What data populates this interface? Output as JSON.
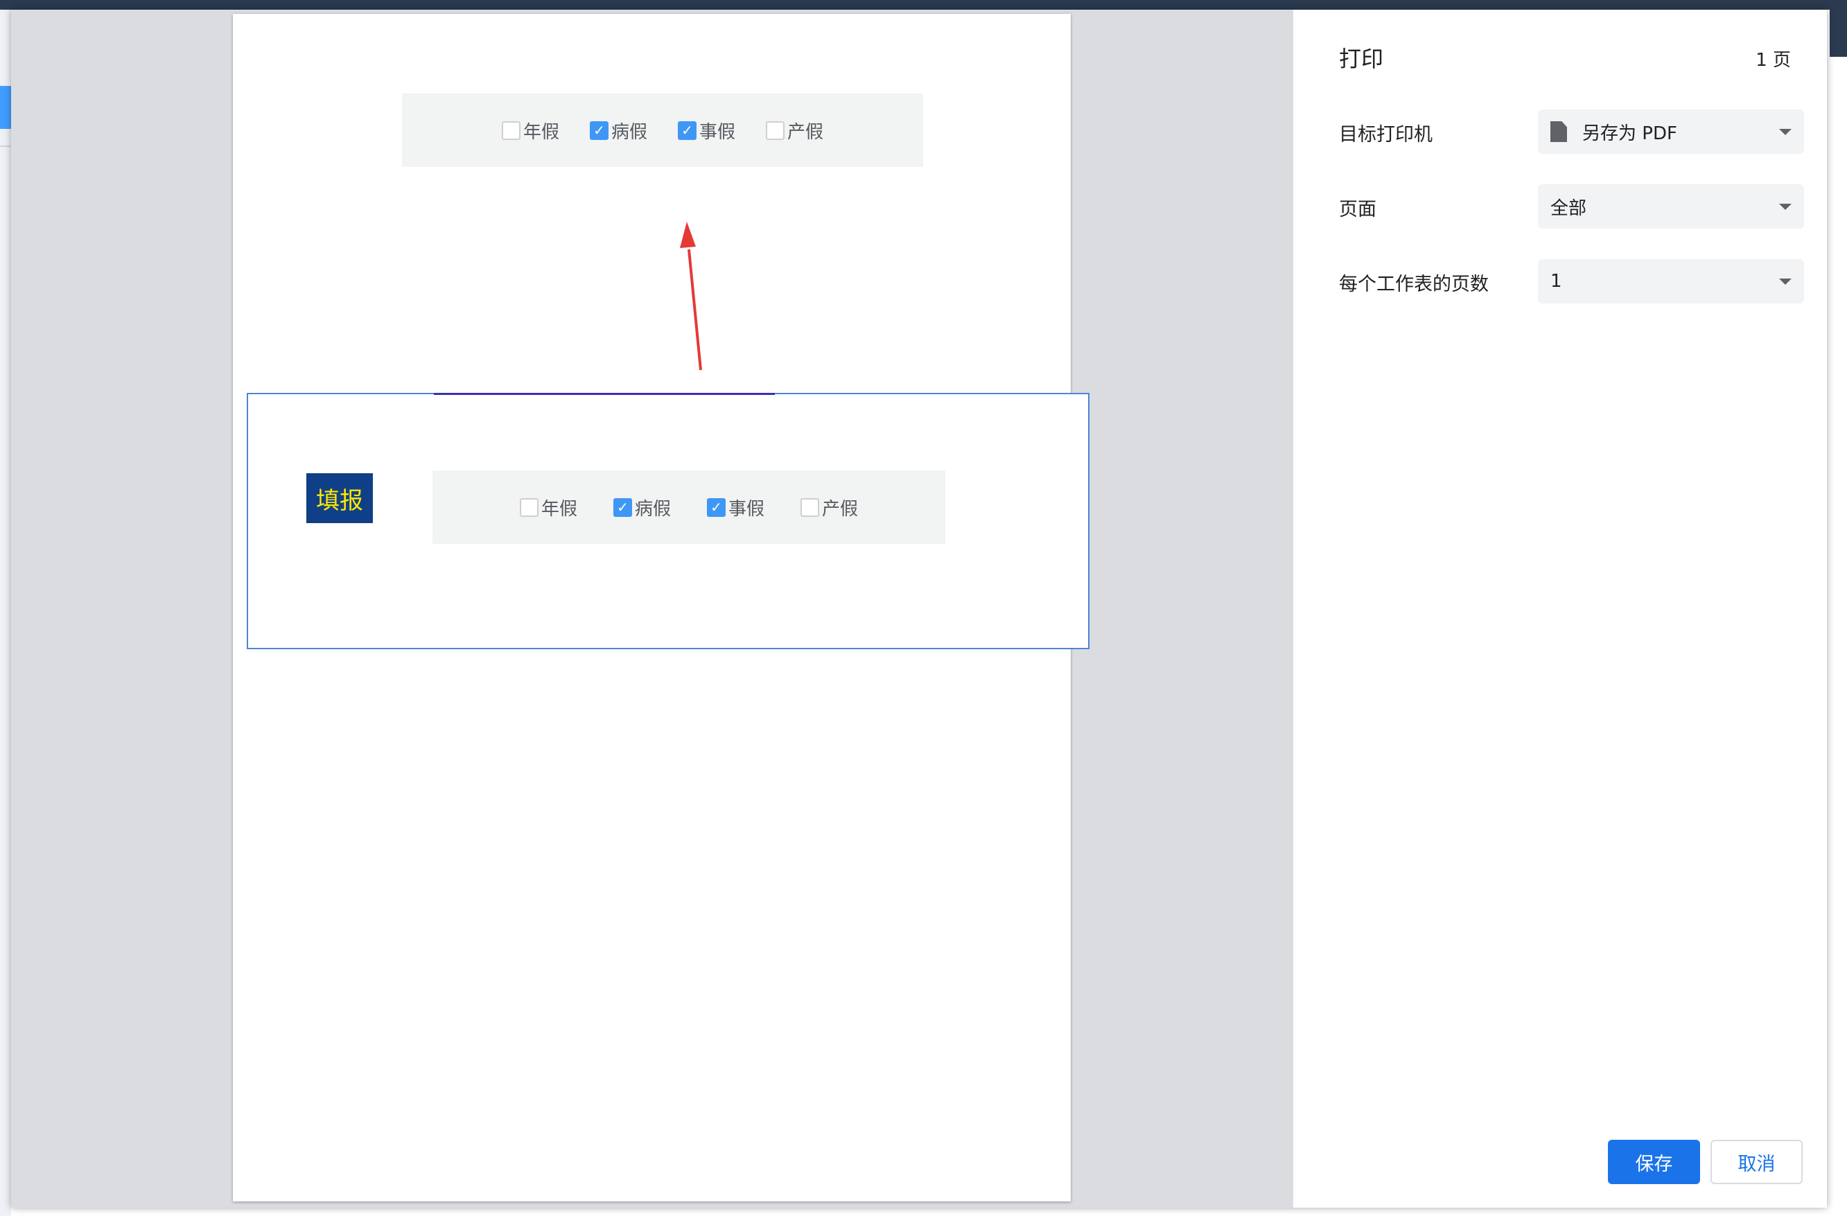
{
  "print_dialog": {
    "title": "打印",
    "page_count": "1 页",
    "destination": {
      "label": "目标打印机",
      "value": "另存为 PDF",
      "icon": "document-icon"
    },
    "pages": {
      "label": "页面",
      "value": "全部"
    },
    "pages_per_sheet": {
      "label": "每个工作表的页数",
      "value": "1"
    },
    "save_button": "保存",
    "cancel_button": "取消"
  },
  "preview": {
    "checkboxes": [
      {
        "label": "年假",
        "checked": false
      },
      {
        "label": "病假",
        "checked": true
      },
      {
        "label": "事假",
        "checked": true
      },
      {
        "label": "产假",
        "checked": false
      }
    ],
    "fill_button": "填报",
    "annotation_arrow_color": "#e53935"
  },
  "colors": {
    "accent": "#1a73e8",
    "checkbox_checked": "#3f97f5",
    "fill_button_bg": "#0f3f86",
    "fill_button_text": "#ffe600"
  }
}
